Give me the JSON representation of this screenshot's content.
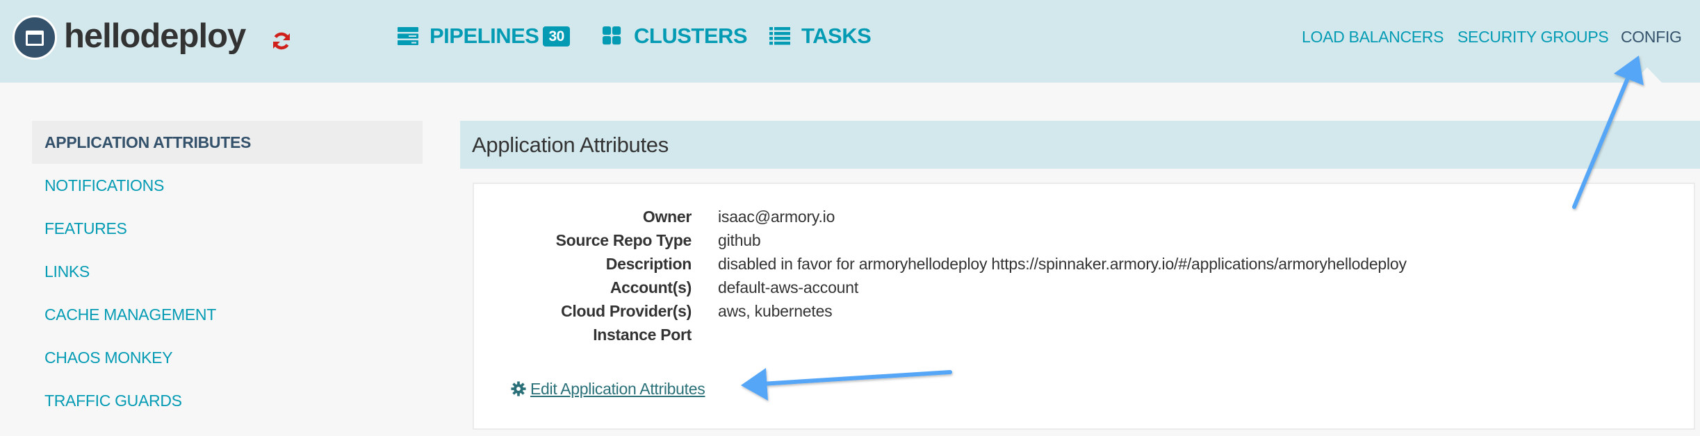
{
  "header": {
    "app_name": "hellodeploy",
    "logo_icon": "application-window-icon",
    "refresh_icon": "refresh-icon",
    "refresh_color": "#d0201c",
    "primary_nav": [
      {
        "label": "PIPELINES",
        "icon": "pipelines-icon",
        "badge": "30"
      },
      {
        "label": "CLUSTERS",
        "icon": "clusters-grid-icon"
      },
      {
        "label": "TASKS",
        "icon": "tasks-list-icon"
      }
    ],
    "secondary_nav": [
      {
        "label": "LOAD BALANCERS",
        "active": false
      },
      {
        "label": "SECURITY GROUPS",
        "active": false
      },
      {
        "label": "CONFIG",
        "active": true
      }
    ]
  },
  "sidebar": {
    "items": [
      {
        "label": "APPLICATION ATTRIBUTES",
        "active": true
      },
      {
        "label": "NOTIFICATIONS",
        "active": false
      },
      {
        "label": "FEATURES",
        "active": false
      },
      {
        "label": "LINKS",
        "active": false
      },
      {
        "label": "CACHE MANAGEMENT",
        "active": false
      },
      {
        "label": "CHAOS MONKEY",
        "active": false
      },
      {
        "label": "TRAFFIC GUARDS",
        "active": false
      }
    ]
  },
  "main": {
    "section_title": "Application Attributes",
    "attributes": [
      {
        "label": "Owner",
        "value": "isaac@armory.io"
      },
      {
        "label": "Source Repo Type",
        "value": "github"
      },
      {
        "label": "Description",
        "value": "disabled in favor for armoryhellodeploy https://spinnaker.armory.io/#/applications/armoryhellodeploy"
      },
      {
        "label": "Account(s)",
        "value": "default-aws-account"
      },
      {
        "label": "Cloud Provider(s)",
        "value": "aws, kubernetes"
      },
      {
        "label": "Instance Port",
        "value": ""
      }
    ],
    "edit_link": {
      "label": "Edit Application Attributes",
      "icon": "gear-icon"
    }
  },
  "annotations": {
    "arrow_color": "#56a6f8",
    "arrows": [
      {
        "points_to": "CONFIG"
      },
      {
        "points_to": "Edit Application Attributes"
      }
    ]
  },
  "colors": {
    "header_bg": "#d3e8ec",
    "nav_accent": "#039bb4",
    "active_text": "#34526b",
    "link": "#2a7078",
    "page_bg": "#f7f7f7"
  }
}
